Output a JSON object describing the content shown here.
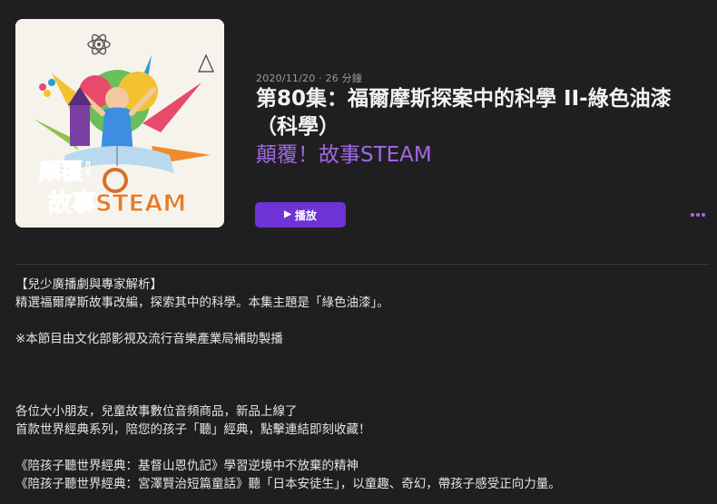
{
  "episode": {
    "meta": "2020/11/20 · 26 分鐘",
    "title_line1": "第80集：福爾摩斯探案中的科學 II-綠色油漆",
    "title_line2": "（科學）",
    "show_title": "顛覆！故事STEAM",
    "play_label": "播放",
    "artwork_text_line1": "顛覆！",
    "artwork_text_line2": "故事STEAM"
  },
  "description": {
    "lines": [
      "【兒少廣播劇與專家解析】",
      "精選福爾摩斯故事改編，探索其中的科學。本集主題是「綠色油漆」。",
      "※本節目由文化部影視及流行音樂產業局補助製播",
      "各位大小朋友，兒童故事數位音頻商品，新品上線了",
      "首款世界經典系列，陪您的孩子「聽」經典，點擊連結即刻收藏！",
      "《陪孩子聽世界經典：基督山恩仇記》學習逆境中不放棄的精神",
      "《陪孩子聽世界經典：宮澤賢治短篇童話》聽「日本安徒生」，以童趣、奇幻，帶孩子感受正向力量。"
    ]
  },
  "colors": {
    "background": "#1f1f21",
    "accent": "#a268e6",
    "button": "#6e33d6",
    "text": "#e6e6e7",
    "muted": "#9a9a9f"
  },
  "icons": {
    "play": "play-icon",
    "more": "more-icon"
  }
}
